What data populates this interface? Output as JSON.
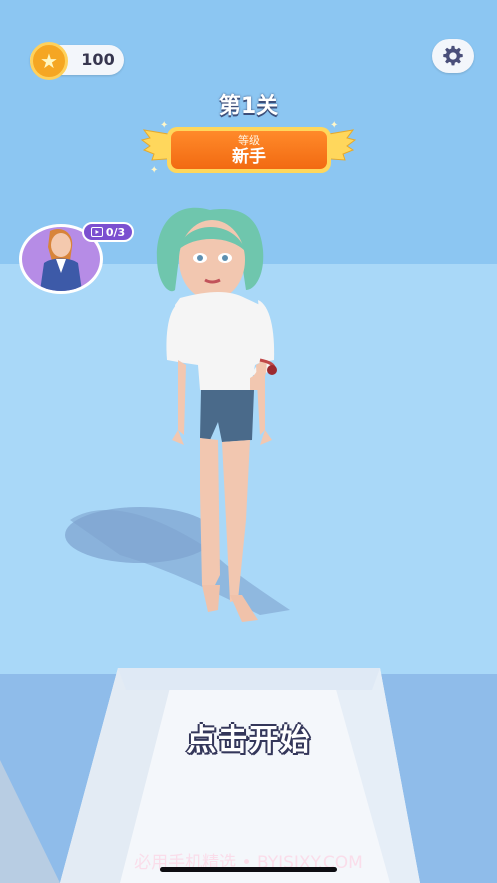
{
  "hud": {
    "coins": "100",
    "level_title": "第1关",
    "rank_label": "等级",
    "rank_value": "新手",
    "ad_progress": "0/3"
  },
  "prompt": {
    "start": "点击开始"
  },
  "watermark": "必用手机精选 • BYJSJXY.COM",
  "icons": {
    "coin": "star-coin-icon",
    "settings": "gear-icon",
    "video": "video-icon"
  },
  "colors": {
    "sky": "#8cc6f2",
    "floor": "#a9d8f8",
    "badge": "#f26a12",
    "badge_frame": "#ffd75c",
    "ad_pill": "#7b4fd0",
    "avatar_bg": "#b68ce6"
  }
}
